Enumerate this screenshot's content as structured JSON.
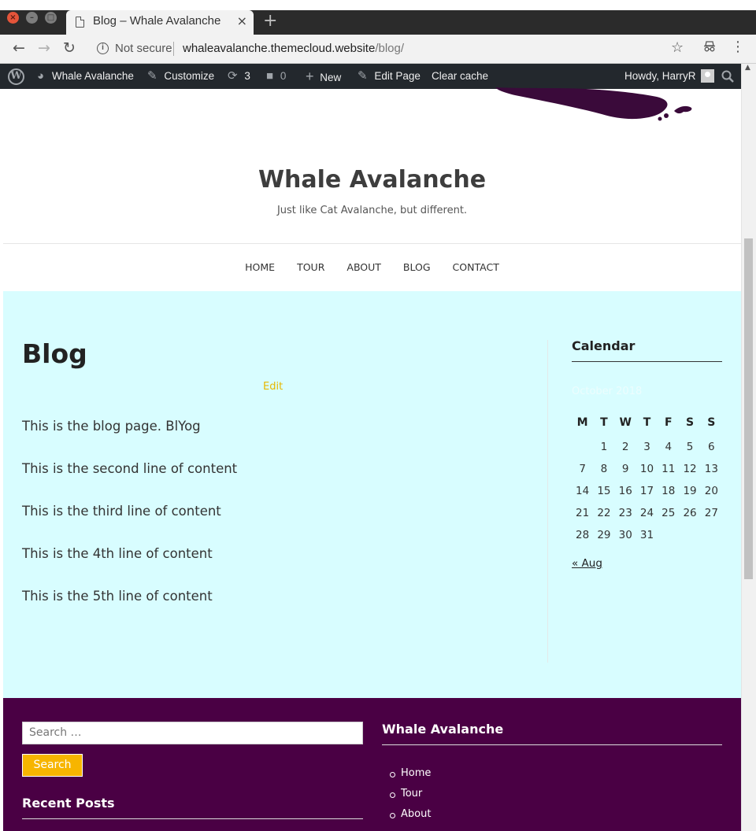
{
  "browser": {
    "tab_title": "Blog – Whale Avalanche",
    "tab_close": "×",
    "new_tab": "+",
    "not_secure": "Not secure",
    "url_host": "whaleavalanche.themecloud.website",
    "url_path": "/blog/"
  },
  "admin_bar": {
    "site_name": "Whale Avalanche",
    "customize": "Customize",
    "updates_count": "3",
    "comments_count": "0",
    "new": "New",
    "edit_page": "Edit Page",
    "clear_cache": "Clear cache",
    "howdy": "Howdy, HarryR"
  },
  "site": {
    "title": "Whale Avalanche",
    "description": "Just like Cat Avalanche, but different."
  },
  "nav": [
    "HOME",
    "TOUR",
    "ABOUT",
    "BLOG",
    "CONTACT"
  ],
  "page": {
    "title": "Blog",
    "edit": "Edit",
    "paragraphs": [
      "This is the blog page. BlYog",
      "This is the second line of content",
      "This is the third line of content",
      "This is the 4th line of content",
      "This is the 5th line of content"
    ]
  },
  "calendar": {
    "title": "Calendar",
    "caption": "October 2018",
    "weekdays": [
      "M",
      "T",
      "W",
      "T",
      "F",
      "S",
      "S"
    ],
    "weeks": [
      [
        "",
        "1",
        "2",
        "3",
        "4",
        "5",
        "6"
      ],
      [
        "7",
        "8",
        "9",
        "10",
        "11",
        "12",
        "13"
      ],
      [
        "14",
        "15",
        "16",
        "17",
        "18",
        "19",
        "20"
      ],
      [
        "21",
        "22",
        "23",
        "24",
        "25",
        "26",
        "27"
      ],
      [
        "28",
        "29",
        "30",
        "31",
        "",
        "",
        ""
      ]
    ],
    "prev": "« Aug"
  },
  "footer": {
    "search_placeholder": "Search …",
    "search_button": "Search",
    "recent_posts": "Recent Posts",
    "menu_title": "Whale Avalanche",
    "menu_items": [
      "Home",
      "Tour",
      "About"
    ]
  },
  "colors": {
    "content_bg": "#d8fdff",
    "footer_bg": "#4a0044",
    "accent": "#f7b500",
    "adminbar_bg": "#23282d"
  }
}
